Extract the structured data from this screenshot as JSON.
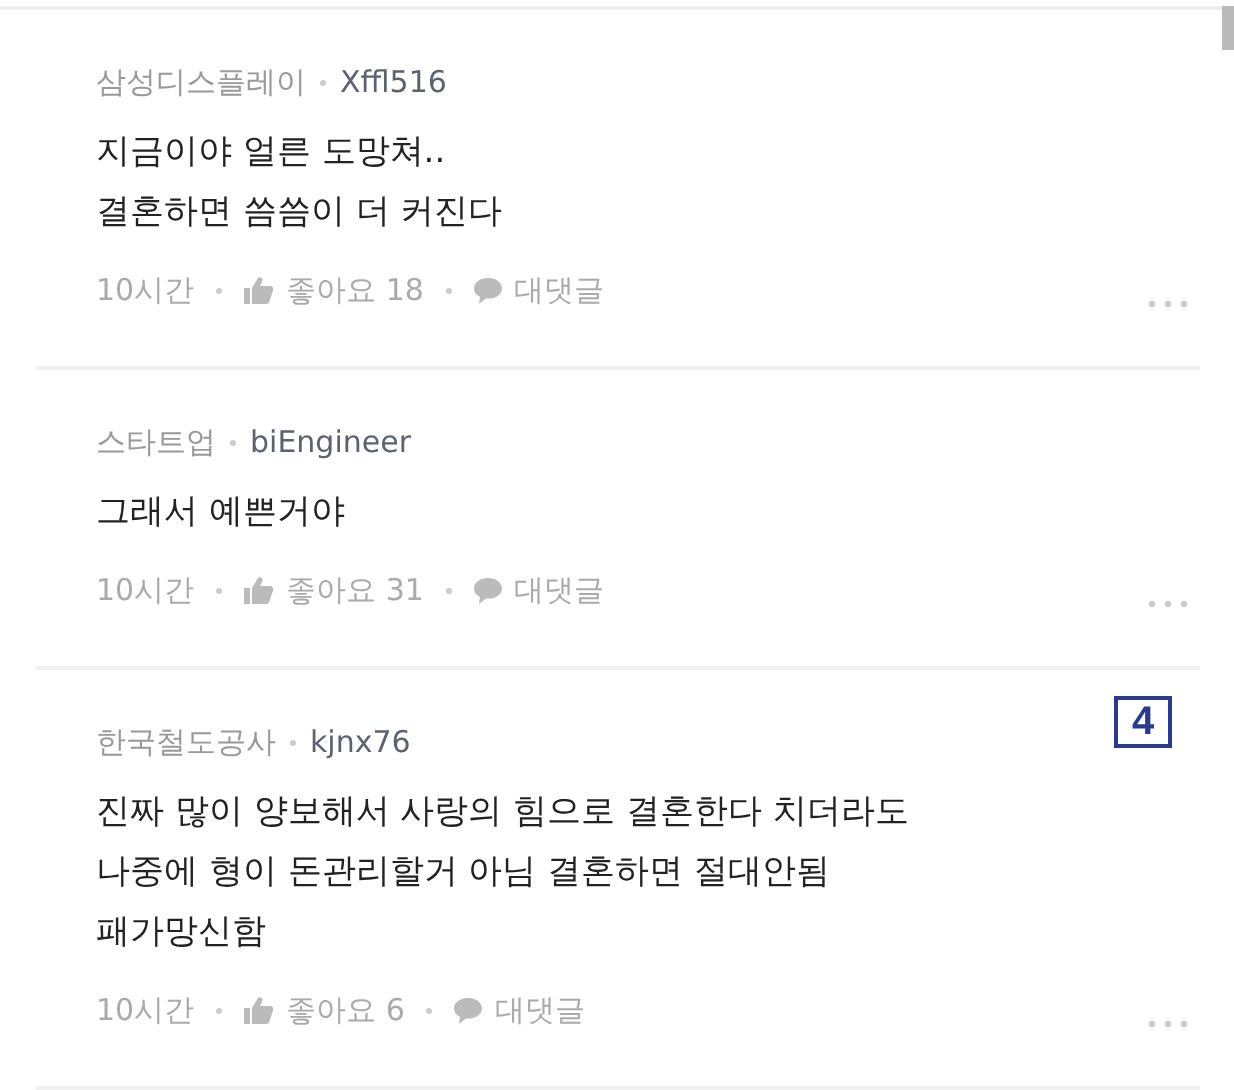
{
  "comments": [
    {
      "company": "삼성디스플레이",
      "user": "Xffl516",
      "lines": [
        "지금이야 얼른 도망쳐..",
        "결혼하면 씀씀이 더 커진다"
      ],
      "time": "10시간",
      "likes": "좋아요 18",
      "reply": "대댓글"
    },
    {
      "company": "스타트업",
      "user": "biEngineer",
      "lines": [
        "그래서 예쁜거야"
      ],
      "time": "10시간",
      "likes": "좋아요 31",
      "reply": "대댓글"
    },
    {
      "company": "한국철도공사",
      "user": "kjnx76",
      "lines": [
        "진짜 많이 양보해서 사랑의 힘으로 결혼한다 치더라도",
        "나중에 형이 돈관리할거 아님 결혼하면 절대안됨",
        "패가망신함"
      ],
      "time": "10시간",
      "likes": "좋아요 6",
      "reply": "대댓글"
    }
  ],
  "page_marker": "4"
}
